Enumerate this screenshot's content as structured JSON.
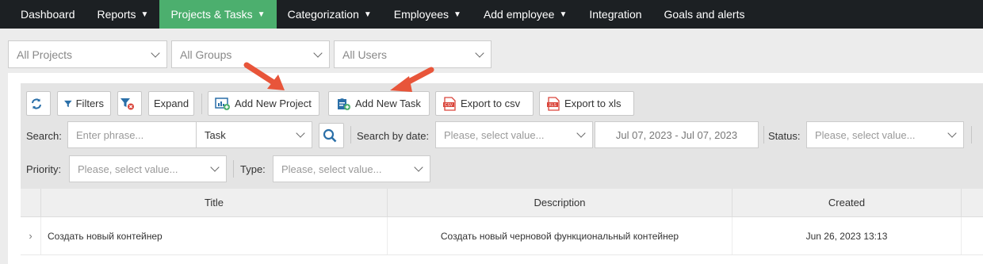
{
  "nav": {
    "items": [
      {
        "label": "Dashboard",
        "caret": false,
        "active": false
      },
      {
        "label": "Reports",
        "caret": true,
        "active": false
      },
      {
        "label": "Projects & Tasks",
        "caret": true,
        "active": true
      },
      {
        "label": "Categorization",
        "caret": true,
        "active": false
      },
      {
        "label": "Employees",
        "caret": true,
        "active": false
      },
      {
        "label": "Add employee",
        "caret": true,
        "active": false
      },
      {
        "label": "Integration",
        "caret": false,
        "active": false
      },
      {
        "label": "Goals and alerts",
        "caret": false,
        "active": false
      }
    ]
  },
  "filters": {
    "projects": "All Projects",
    "groups": "All Groups",
    "users": "All Users"
  },
  "toolbar": {
    "filters_label": "Filters",
    "expand_label": "Expand",
    "add_project_label": "Add New Project",
    "add_task_label": "Add New Task",
    "export_csv_label": "Export to csv",
    "export_xls_label": "Export to xls"
  },
  "search": {
    "label": "Search:",
    "placeholder": "Enter phrase...",
    "scope": "Task",
    "by_date_label": "Search by date:",
    "date_placeholder": "Please, select value...",
    "date_range": "Jul 07, 2023 - Jul 07, 2023",
    "status_label": "Status:",
    "status_placeholder": "Please, select value...",
    "priority_label": "Priority:",
    "priority_placeholder": "Please, select value...",
    "type_label": "Type:",
    "type_placeholder": "Please, select value..."
  },
  "table": {
    "columns": [
      "Title",
      "Description",
      "Created"
    ],
    "rows": [
      {
        "title": "Создать новый контейнер",
        "description": "Создать новый черновой функциональный контейнер",
        "created": "Jun 26, 2023 13:13"
      }
    ]
  },
  "colors": {
    "nav_bg": "#1c2023",
    "nav_active": "#4caf6e",
    "arrow": "#e8553a",
    "icon_blue": "#2a6fa8"
  }
}
